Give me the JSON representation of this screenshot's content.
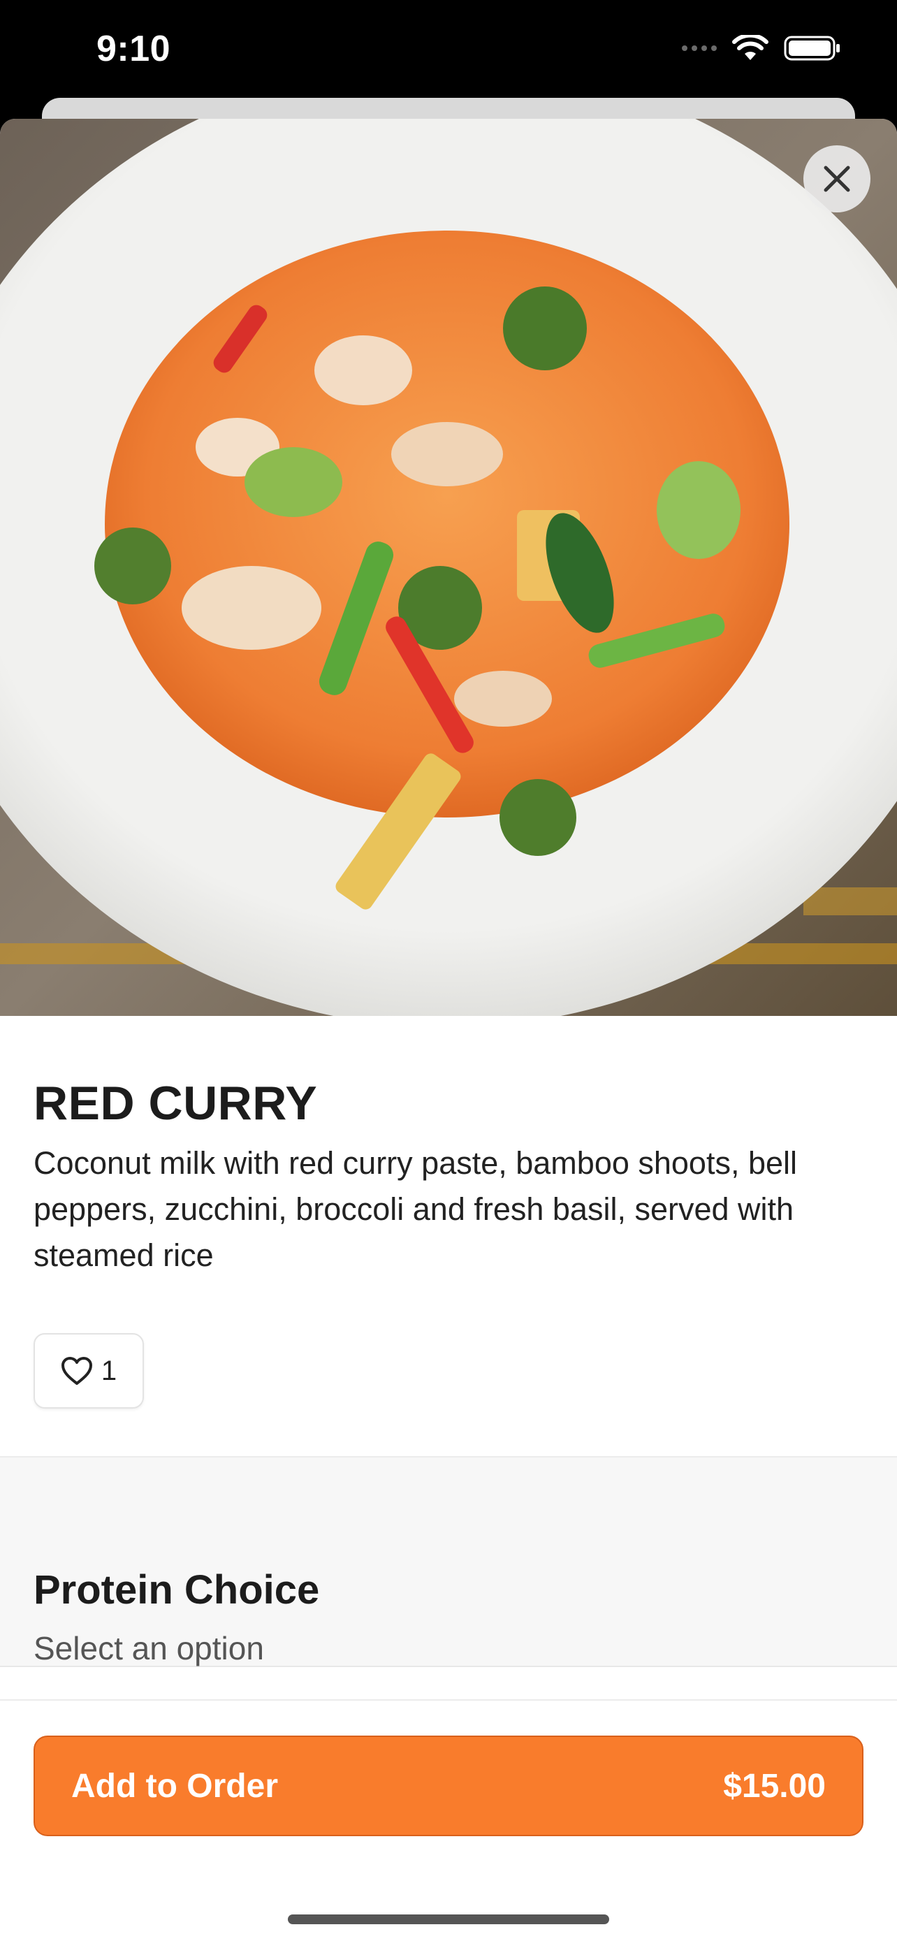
{
  "status_bar": {
    "time": "9:10"
  },
  "item": {
    "name": "RED CURRY",
    "description": "Coconut milk with red curry paste, bamboo shoots, bell peppers, zucchini, broccoli and fresh basil, served with steamed rice",
    "like_count": "1",
    "image_icon": "dish-photo"
  },
  "options_section": {
    "title": "Protein Choice",
    "subtitle": "Select an option"
  },
  "footer": {
    "add_label": "Add to Order",
    "price": "$15.00"
  },
  "colors": {
    "accent": "#f97c2c",
    "accent_border": "#d9601b",
    "text": "#1c1c1c",
    "section_bg": "#f7f7f7"
  }
}
